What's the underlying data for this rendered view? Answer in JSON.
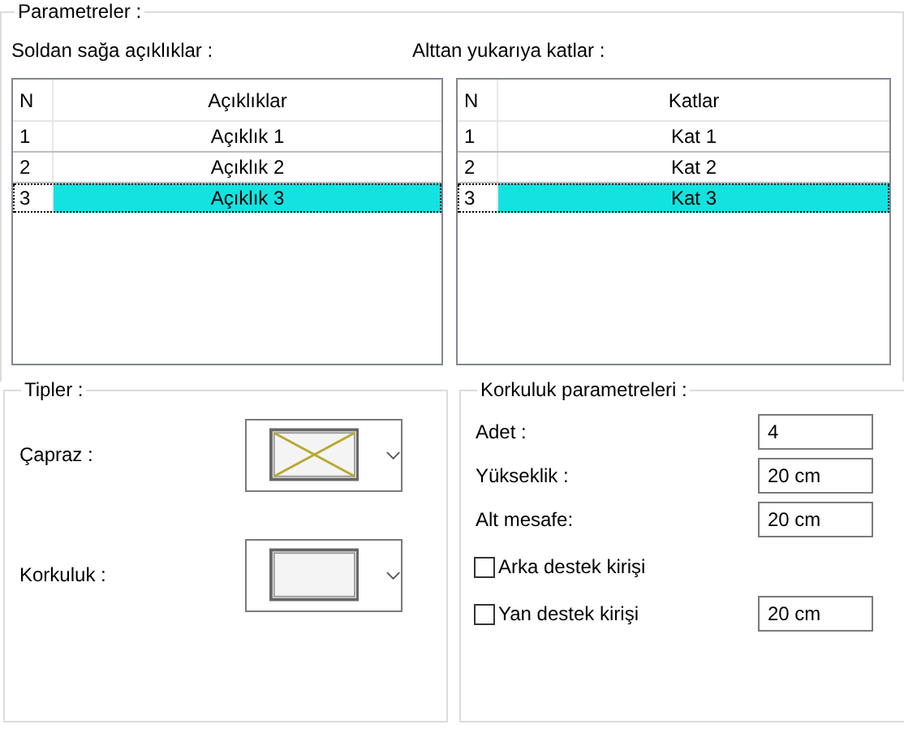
{
  "group_title": "Parametreler :",
  "lists": [
    {
      "label": "Soldan sağa açıklıklar :",
      "columns": [
        "N",
        "Açıklıklar"
      ],
      "rows": [
        {
          "n": "1",
          "name": "Açıklık 1",
          "selected": false
        },
        {
          "n": "2",
          "name": "Açıklık 2",
          "selected": false
        },
        {
          "n": "3",
          "name": "Açıklık 3",
          "selected": true
        }
      ]
    },
    {
      "label": "Alttan yukarıya katlar :",
      "columns": [
        "N",
        "Katlar"
      ],
      "rows": [
        {
          "n": "1",
          "name": "Kat 1",
          "selected": false
        },
        {
          "n": "2",
          "name": "Kat 2",
          "selected": false
        },
        {
          "n": "3",
          "name": "Kat 3",
          "selected": true
        }
      ]
    }
  ],
  "types": {
    "title": "Tipler :",
    "items": [
      {
        "label": "Çapraz :",
        "kind": "cross"
      },
      {
        "label": "Korkuluk :",
        "kind": "plain"
      }
    ]
  },
  "params": {
    "title": "Korkuluk parametreleri :",
    "items": [
      {
        "kind": "field",
        "label": "Adet :",
        "value": "4"
      },
      {
        "kind": "field",
        "label": "Yükseklik :",
        "value": "20 cm"
      },
      {
        "kind": "field",
        "label": "Alt mesafe:",
        "value": "20 cm"
      },
      {
        "kind": "checkbox",
        "label": "Arka destek kirişi",
        "checked": false
      },
      {
        "kind": "checkbox",
        "label": "Yan destek kirişi",
        "checked": false,
        "value": "20 cm"
      }
    ]
  }
}
